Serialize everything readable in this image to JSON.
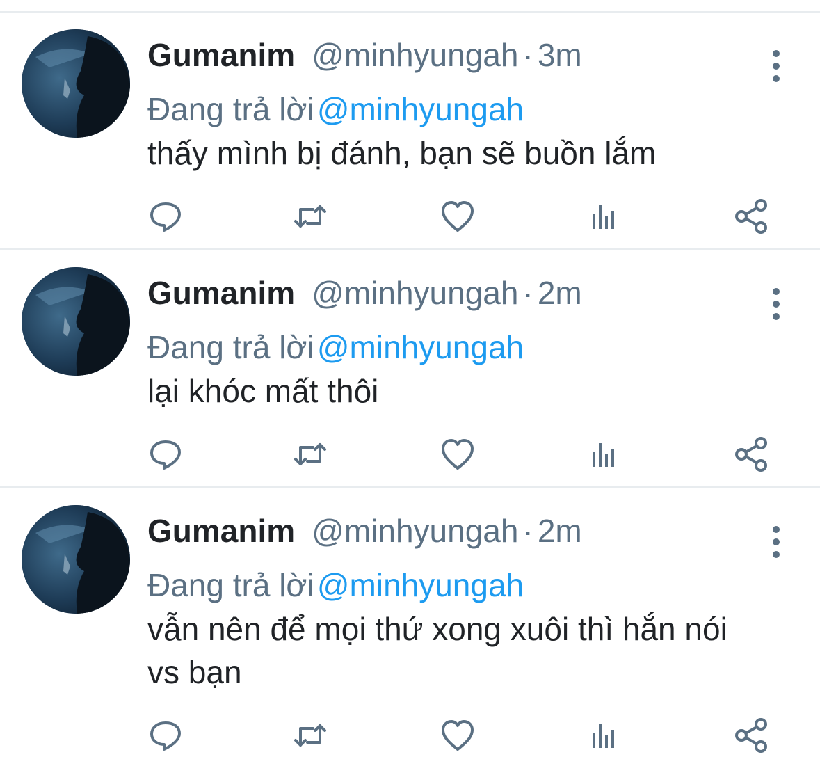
{
  "colors": {
    "text_primary": "#202327",
    "text_secondary": "#5b7083",
    "link": "#1d9bf0",
    "divider": "#e8ecef"
  },
  "tweets": [
    {
      "display_name": "Gumanim",
      "handle": "@minhyungah",
      "separator": "·",
      "time": "3m",
      "reply_prefix": "Đang trả lời",
      "reply_to": "@minhyungah",
      "text": "thấy mình bị đánh, bạn sẽ buồn lắm"
    },
    {
      "display_name": "Gumanim",
      "handle": "@minhyungah",
      "separator": "·",
      "time": "2m",
      "reply_prefix": "Đang trả lời",
      "reply_to": "@minhyungah",
      "text": "lại khóc mất thôi"
    },
    {
      "display_name": "Gumanim",
      "handle": "@minhyungah",
      "separator": "·",
      "time": "2m",
      "reply_prefix": "Đang trả lời",
      "reply_to": "@minhyungah",
      "text": "vẫn nên để mọi thứ xong xuôi thì hắn nói vs bạn"
    }
  ],
  "icons": {
    "more": "vertical-ellipsis-icon",
    "reply": "reply-bubble-icon",
    "retweet": "retweet-icon",
    "like": "heart-icon",
    "analytics": "analytics-bars-icon",
    "share": "share-icon"
  }
}
